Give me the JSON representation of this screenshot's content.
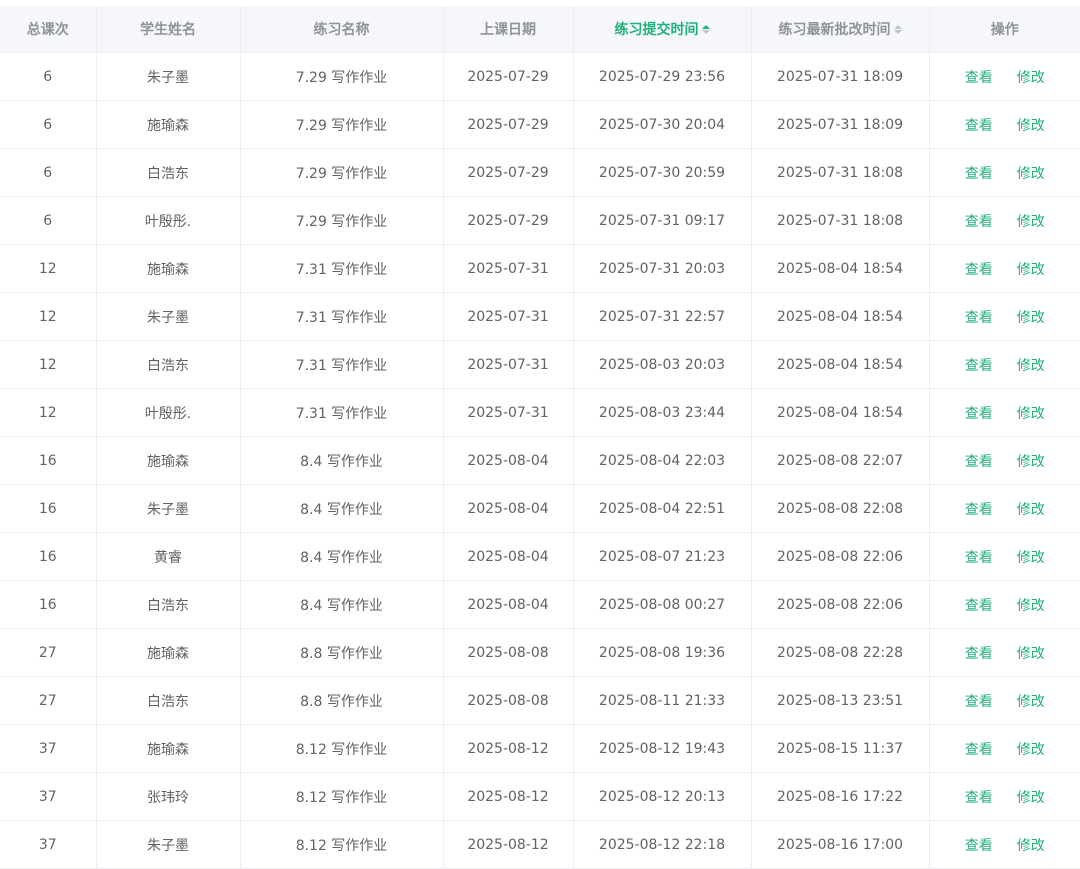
{
  "colors": {
    "accent": "#20b27a",
    "header_bg": "#f5f7fa",
    "text": "#606266",
    "header_text": "#909399"
  },
  "table": {
    "columns": {
      "lesson_count": "总课次",
      "student_name": "学生姓名",
      "exercise_name": "练习名称",
      "class_date": "上课日期",
      "submit_time": "练习提交时间",
      "review_time": "练习最新批改时间",
      "actions": "操作"
    },
    "sort": {
      "column": "submit_time",
      "direction": "ascending"
    },
    "action_labels": {
      "view": "查看",
      "edit": "修改"
    },
    "rows": [
      {
        "lesson_count": "6",
        "student_name": "朱子墨",
        "exercise_name": "7.29 写作作业",
        "class_date": "2025-07-29",
        "submit_time": "2025-07-29 23:56",
        "review_time": "2025-07-31 18:09"
      },
      {
        "lesson_count": "6",
        "student_name": "施瑜森",
        "exercise_name": "7.29 写作作业",
        "class_date": "2025-07-29",
        "submit_time": "2025-07-30 20:04",
        "review_time": "2025-07-31 18:09"
      },
      {
        "lesson_count": "6",
        "student_name": "白浩东",
        "exercise_name": "7.29 写作作业",
        "class_date": "2025-07-29",
        "submit_time": "2025-07-30 20:59",
        "review_time": "2025-07-31 18:08"
      },
      {
        "lesson_count": "6",
        "student_name": "叶殷彤.",
        "exercise_name": "7.29 写作作业",
        "class_date": "2025-07-29",
        "submit_time": "2025-07-31 09:17",
        "review_time": "2025-07-31 18:08"
      },
      {
        "lesson_count": "12",
        "student_name": "施瑜森",
        "exercise_name": "7.31 写作作业",
        "class_date": "2025-07-31",
        "submit_time": "2025-07-31 20:03",
        "review_time": "2025-08-04 18:54"
      },
      {
        "lesson_count": "12",
        "student_name": "朱子墨",
        "exercise_name": "7.31 写作作业",
        "class_date": "2025-07-31",
        "submit_time": "2025-07-31 22:57",
        "review_time": "2025-08-04 18:54"
      },
      {
        "lesson_count": "12",
        "student_name": "白浩东",
        "exercise_name": "7.31 写作作业",
        "class_date": "2025-07-31",
        "submit_time": "2025-08-03 20:03",
        "review_time": "2025-08-04 18:54"
      },
      {
        "lesson_count": "12",
        "student_name": "叶殷彤.",
        "exercise_name": "7.31 写作作业",
        "class_date": "2025-07-31",
        "submit_time": "2025-08-03 23:44",
        "review_time": "2025-08-04 18:54"
      },
      {
        "lesson_count": "16",
        "student_name": "施瑜森",
        "exercise_name": "8.4 写作作业",
        "class_date": "2025-08-04",
        "submit_time": "2025-08-04 22:03",
        "review_time": "2025-08-08 22:07"
      },
      {
        "lesson_count": "16",
        "student_name": "朱子墨",
        "exercise_name": "8.4 写作作业",
        "class_date": "2025-08-04",
        "submit_time": "2025-08-04 22:51",
        "review_time": "2025-08-08 22:08"
      },
      {
        "lesson_count": "16",
        "student_name": "黄睿",
        "exercise_name": "8.4 写作作业",
        "class_date": "2025-08-04",
        "submit_time": "2025-08-07 21:23",
        "review_time": "2025-08-08 22:06"
      },
      {
        "lesson_count": "16",
        "student_name": "白浩东",
        "exercise_name": "8.4 写作作业",
        "class_date": "2025-08-04",
        "submit_time": "2025-08-08 00:27",
        "review_time": "2025-08-08 22:06"
      },
      {
        "lesson_count": "27",
        "student_name": "施瑜森",
        "exercise_name": "8.8 写作作业",
        "class_date": "2025-08-08",
        "submit_time": "2025-08-08 19:36",
        "review_time": "2025-08-08 22:28"
      },
      {
        "lesson_count": "27",
        "student_name": "白浩东",
        "exercise_name": "8.8 写作作业",
        "class_date": "2025-08-08",
        "submit_time": "2025-08-11 21:33",
        "review_time": "2025-08-13 23:51"
      },
      {
        "lesson_count": "37",
        "student_name": "施瑜森",
        "exercise_name": "8.12 写作作业",
        "class_date": "2025-08-12",
        "submit_time": "2025-08-12 19:43",
        "review_time": "2025-08-15 11:37"
      },
      {
        "lesson_count": "37",
        "student_name": "张玮玲",
        "exercise_name": "8.12 写作作业",
        "class_date": "2025-08-12",
        "submit_time": "2025-08-12 20:13",
        "review_time": "2025-08-16 17:22"
      },
      {
        "lesson_count": "37",
        "student_name": "朱子墨",
        "exercise_name": "8.12 写作作业",
        "class_date": "2025-08-12",
        "submit_time": "2025-08-12 22:18",
        "review_time": "2025-08-16 17:00"
      }
    ]
  }
}
